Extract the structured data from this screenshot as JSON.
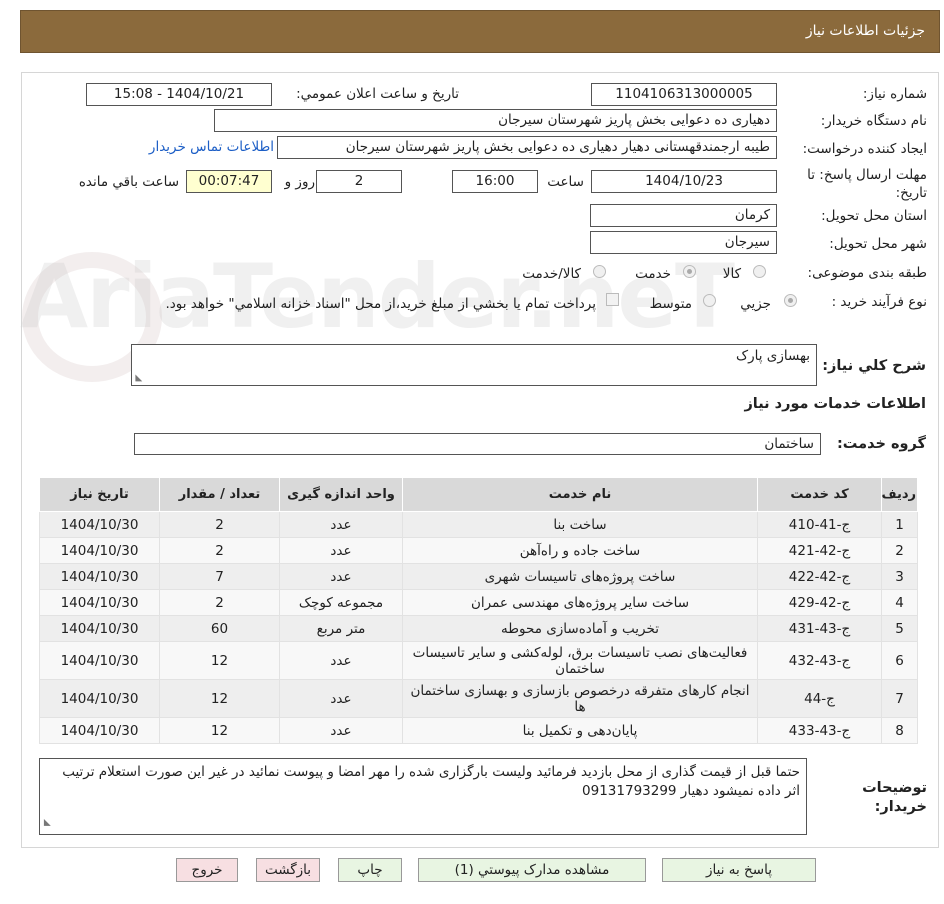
{
  "header": {
    "title": "جزئیات اطلاعات نیاز"
  },
  "watermark": "AriaTender.neT",
  "form": {
    "need_number_label": "شماره نیاز:",
    "need_number": "1104106313000005",
    "announce_label": "تاریخ و ساعت اعلان عمومي:",
    "announce_value": "1404/10/21 - 15:08",
    "buyer_org_label": "نام دستگاه خريدار:",
    "buyer_org": "دهیاری ده دعوایی بخش پاریز شهرستان سیرجان",
    "creator_label": "ايجاد كننده درخواست:",
    "creator": "طیبه ارجمندقهستانی دهیار دهیاری ده دعوایی بخش پاریز شهرستان سیرجان",
    "contact_link": "اطلاعات تماس خریدار",
    "deadline_label": "مهلت ارسال پاسخ: تا تاریخ:",
    "deadline_date": "1404/10/23",
    "time_label": "ساعت",
    "deadline_time": "16:00",
    "days_value": "2",
    "days_label": "روز و",
    "remaining_time": "00:07:47",
    "remaining_label": "ساعت باقي مانده",
    "province_label": "استان محل تحويل:",
    "province": "کرمان",
    "city_label": "شهر محل تحويل:",
    "city": "سیرجان",
    "category_label": "طبقه بندی موضوعی:",
    "category_options": [
      "کالا",
      "خدمت",
      "کالا/خدمت"
    ],
    "category_selected": "خدمت",
    "process_label": "نوع فرآيند خريد :",
    "process_options": [
      "جزيي",
      "متوسط"
    ],
    "process_selected": "جزيي",
    "payment_note": "پرداخت تمام يا بخشي از مبلغ خريد،از محل \"اسناد خزانه اسلامي\" خواهد بود."
  },
  "summary": {
    "label": "شرح كلي نياز:",
    "value": "بهسازی پارک"
  },
  "services": {
    "section_title": "اطلاعات خدمات مورد نياز",
    "group_label": "گروه خدمت:",
    "group_value": "ساختمان",
    "columns": [
      "رديف",
      "کد خدمت",
      "نام خدمت",
      "واحد اندازه گيری",
      "تعداد / مقدار",
      "تاريخ نياز"
    ],
    "rows": [
      [
        "1",
        "ج-41-410",
        "ساخت بنا",
        "عدد",
        "2",
        "1404/10/30"
      ],
      [
        "2",
        "ج-42-421",
        "ساخت جاده و راه‌آهن",
        "عدد",
        "2",
        "1404/10/30"
      ],
      [
        "3",
        "ج-42-422",
        "ساخت پروژه‌های تاسیسات شهری",
        "عدد",
        "7",
        "1404/10/30"
      ],
      [
        "4",
        "ج-42-429",
        "ساخت سایر پروژه‌های مهندسی عمران",
        "مجموعه کوچک",
        "2",
        "1404/10/30"
      ],
      [
        "5",
        "ج-43-431",
        "تخریب و آماده‌سازی محوطه",
        "متر مربع",
        "60",
        "1404/10/30"
      ],
      [
        "6",
        "ج-43-432",
        "فعالیت‌های نصب تاسیسات برق، لوله‌کشی و سایر تاسیسات ساختمان",
        "عدد",
        "12",
        "1404/10/30"
      ],
      [
        "7",
        "ج-44",
        "انجام کارهای متفرقه درخصوص بازسازی و بهسازی ساختمان ها",
        "عدد",
        "12",
        "1404/10/30"
      ],
      [
        "8",
        "ج-43-433",
        "پایان‌دهی و تکمیل بنا",
        "عدد",
        "12",
        "1404/10/30"
      ]
    ]
  },
  "buyer_notes": {
    "label": "توضيحات خريدار:",
    "value": "حتما قبل از قیمت گذاری از محل بازدید فرمائید ولیست بارگزاری شده را مهر امضا و پیوست نمائید در غیر این صورت استعلام ترتیب اثر داده نمیشود دهیار 09131793299"
  },
  "buttons": {
    "reply": "پاسخ به نياز",
    "attachments": "مشاهده مدارک پيوستي (1)",
    "print": "چاپ",
    "back": "بازگشت",
    "exit": "خروج"
  }
}
